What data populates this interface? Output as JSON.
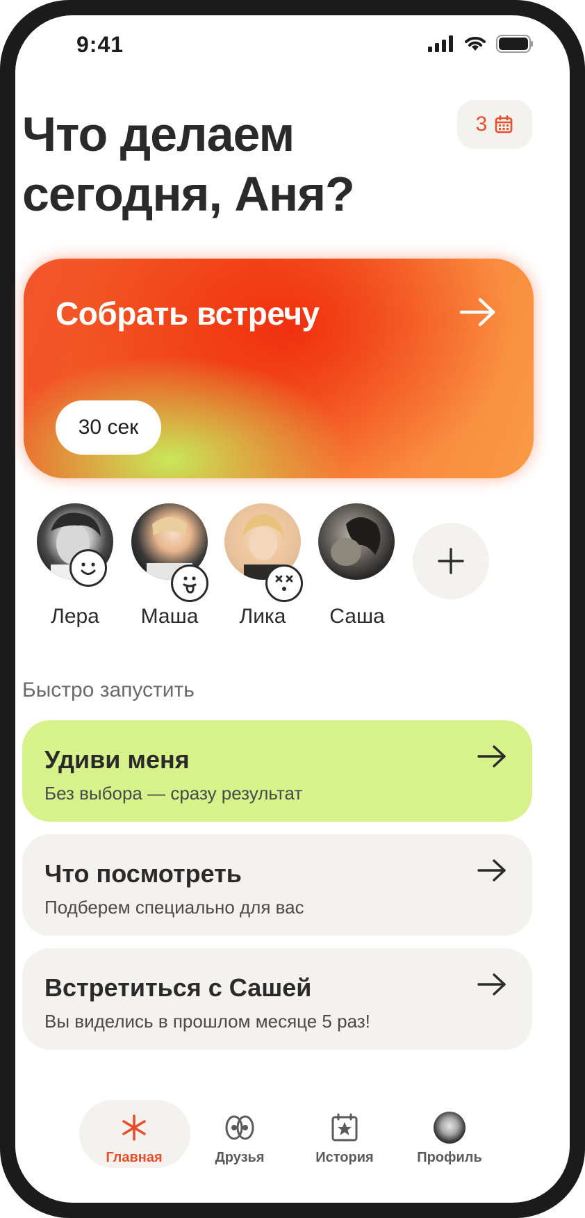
{
  "status_bar": {
    "time": "9:41"
  },
  "header": {
    "title": "Что делаем сегодня, Аня?",
    "calendar_count": "3"
  },
  "hero": {
    "title": "Собрать встречу",
    "duration": "30 сек",
    "colors": {
      "red": "#f0300f",
      "orange": "#fa9a45",
      "lime": "#c8e85a"
    }
  },
  "friends": [
    {
      "name": "Лера",
      "mood_icon": "smile-icon"
    },
    {
      "name": "Маша",
      "mood_icon": "tongue-icon"
    },
    {
      "name": "Лика",
      "mood_icon": "dizzy-face-icon"
    },
    {
      "name": "Саша",
      "mood_icon": ""
    }
  ],
  "quick_start": {
    "label": "Быстро запустить",
    "items": [
      {
        "title": "Удиви меня",
        "subtitle": "Без выбора — сразу результат",
        "color": "#d7f28b"
      },
      {
        "title": "Что посмотреть",
        "subtitle": "Подберем специально для вас",
        "color": "#f4f2ee"
      },
      {
        "title": "Встретиться с Сашей",
        "subtitle": "Вы виделись в прошлом месяце 5 раз!",
        "color": "#f4f2ee"
      }
    ]
  },
  "tab_bar": {
    "active": "Главная",
    "items": [
      {
        "label": "Главная",
        "icon": "asterisk-icon"
      },
      {
        "label": "Друзья",
        "icon": "friends-icon"
      },
      {
        "label": "История",
        "icon": "calendar-star-icon"
      },
      {
        "label": "Профиль",
        "icon": "avatar"
      }
    ],
    "accent": "#e94d2a"
  }
}
